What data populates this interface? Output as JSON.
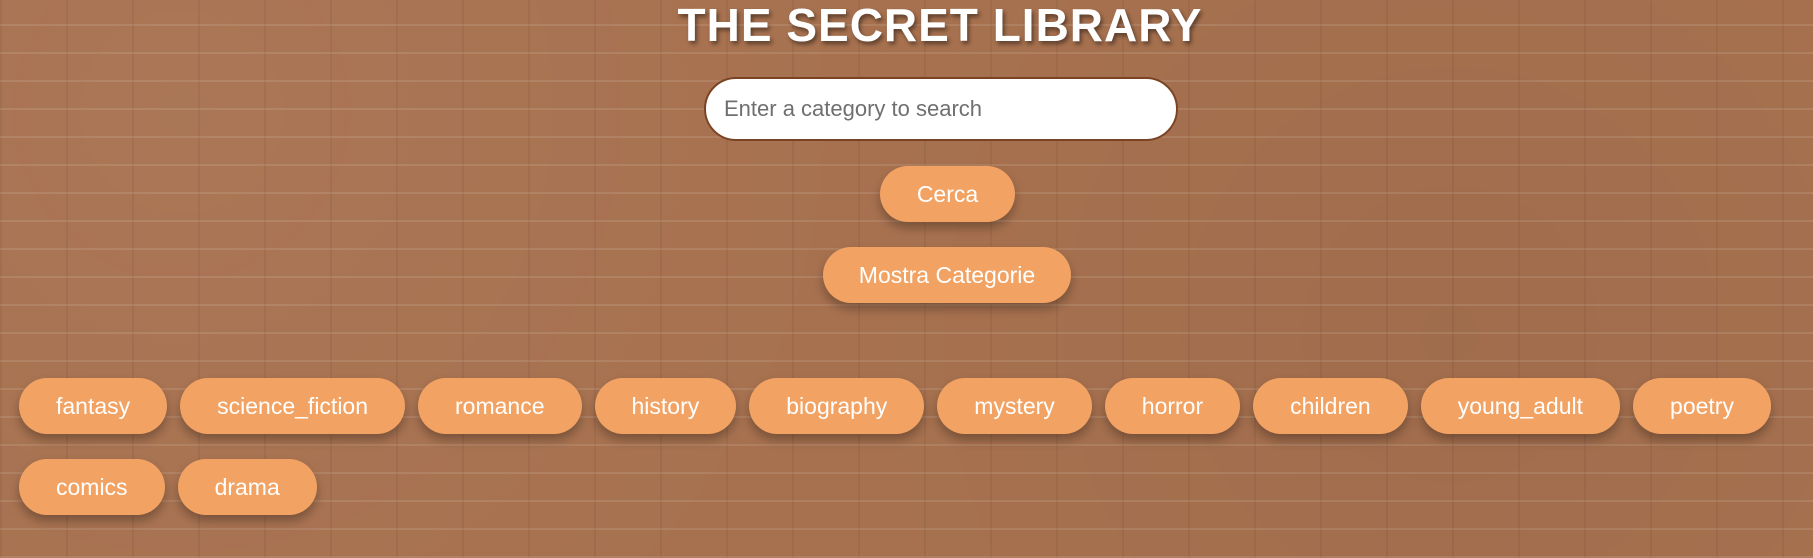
{
  "header": {
    "title": "THE SECRET LIBRARY"
  },
  "search": {
    "placeholder": "Enter a category to search",
    "value": ""
  },
  "buttons": {
    "search_label": "Cerca",
    "show_categories_label": "Mostra Categorie"
  },
  "categories": [
    "fantasy",
    "science_fiction",
    "romance",
    "history",
    "biography",
    "mystery",
    "horror",
    "children",
    "young_adult",
    "poetry",
    "comics",
    "drama"
  ],
  "colors": {
    "background": "#a7714f",
    "button": "#f2a363",
    "button_text": "#ffffff",
    "input_border": "#7a4424",
    "title": "#ffffff"
  }
}
